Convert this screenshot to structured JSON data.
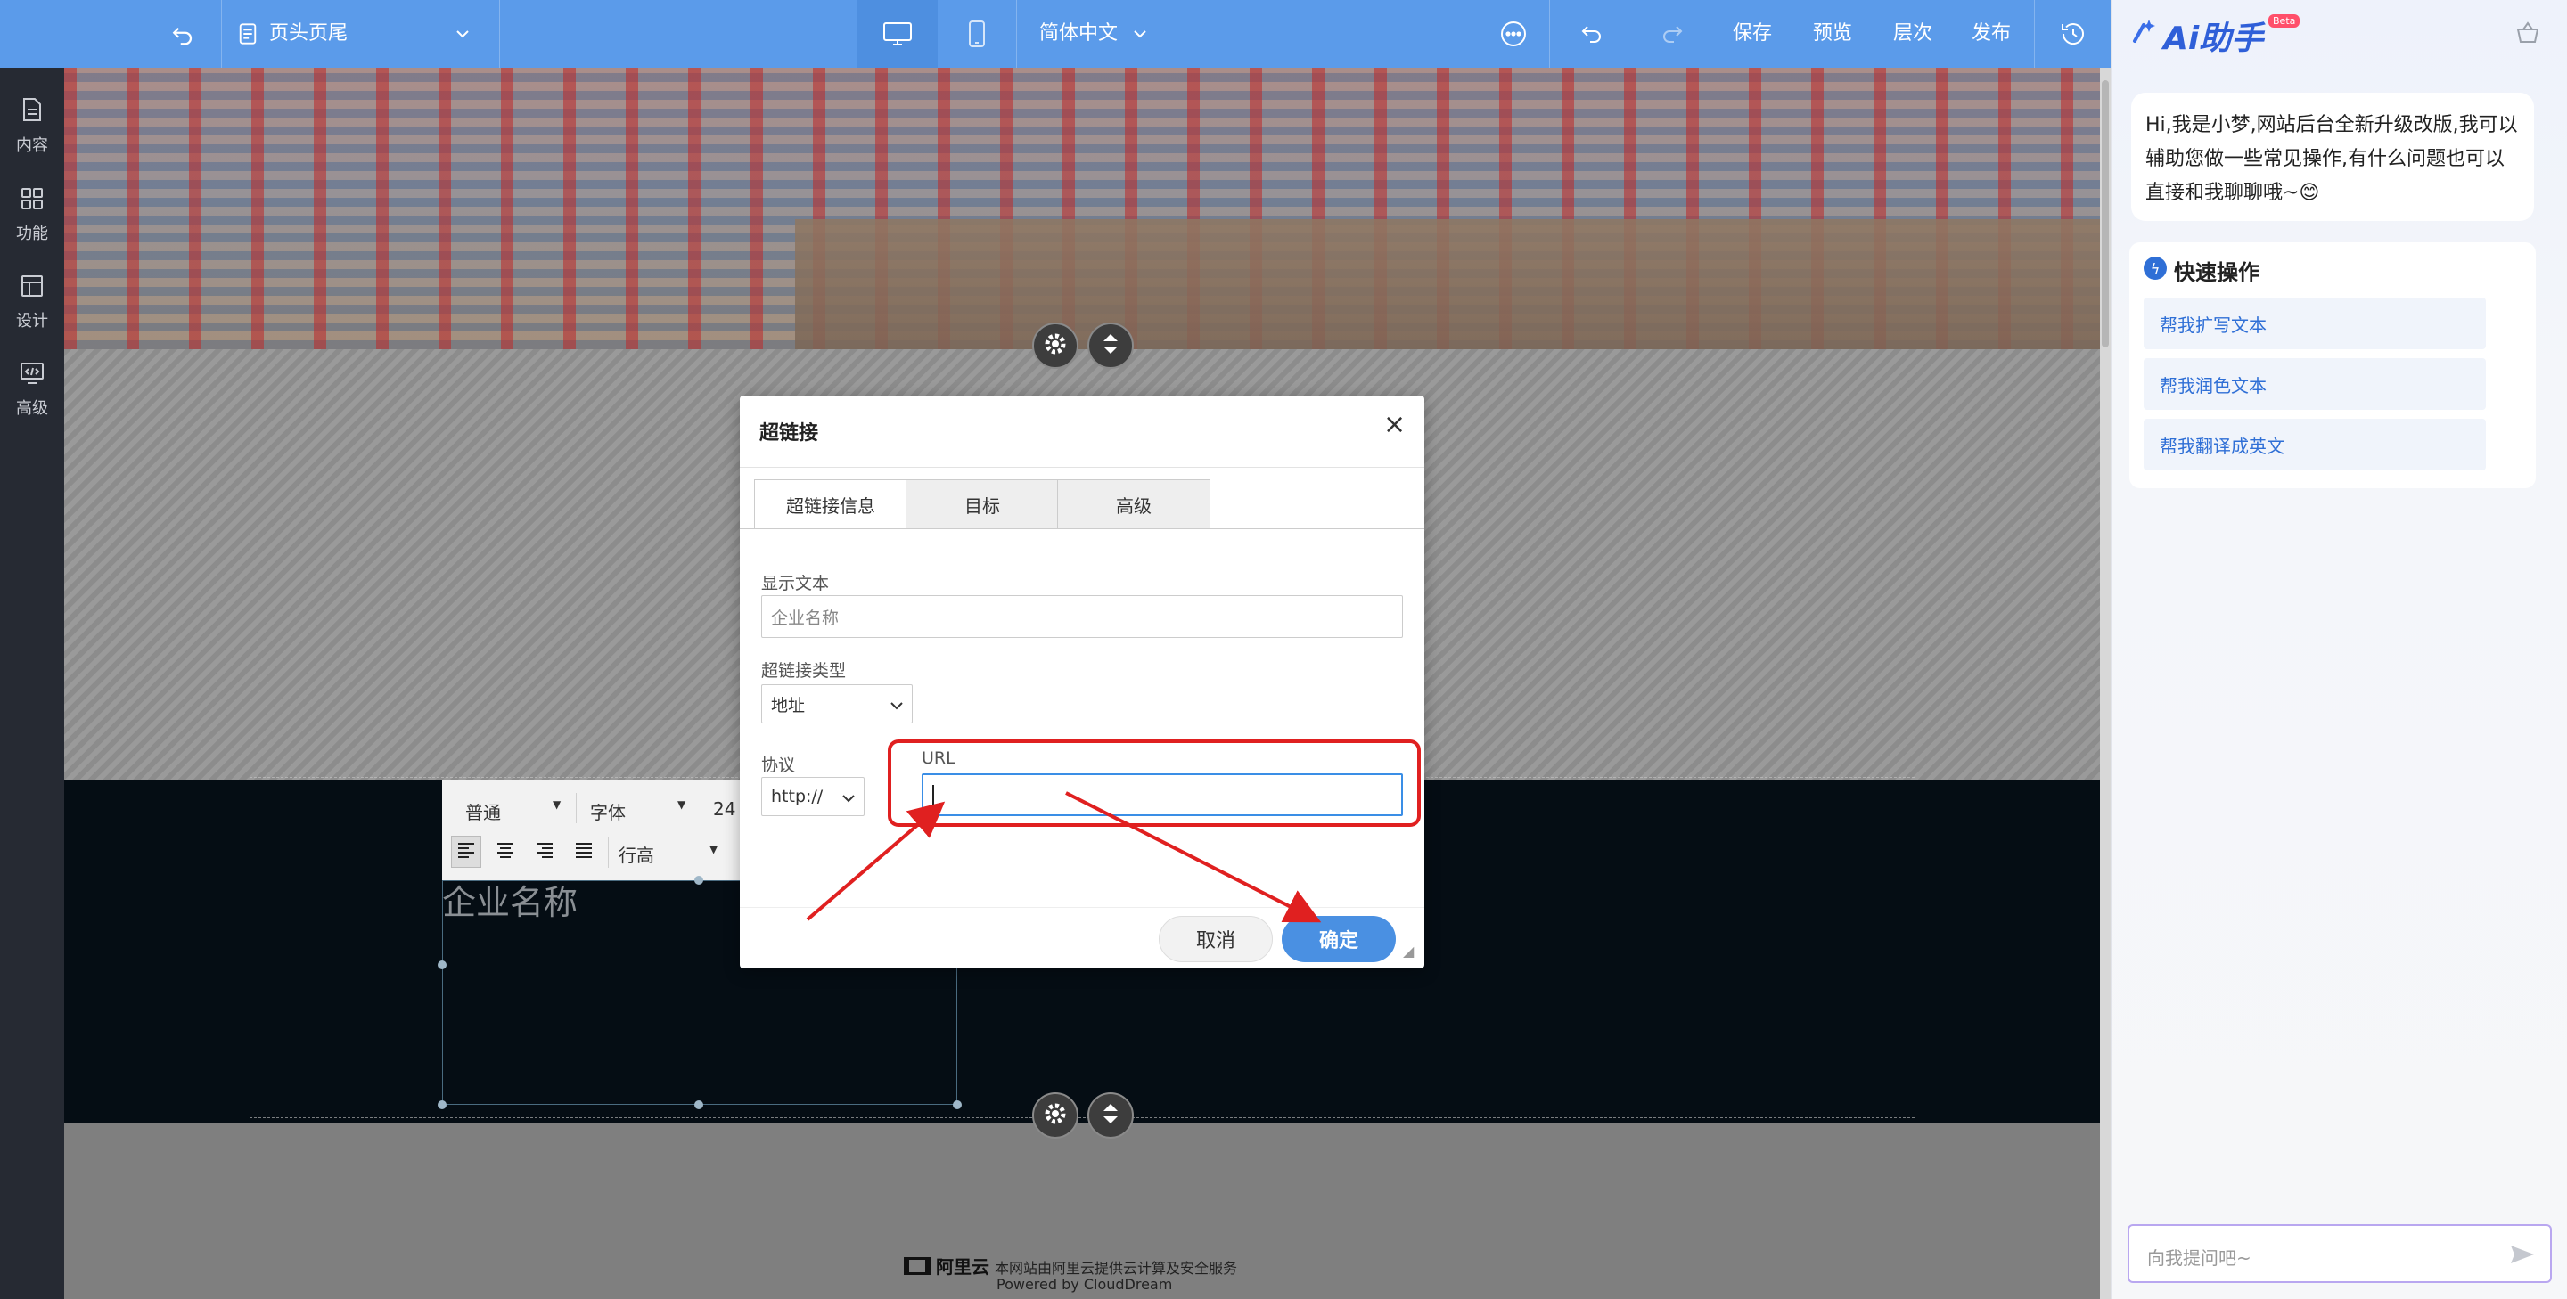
{
  "topbar": {
    "page_selector": "页头页尾",
    "language": "简体中文",
    "save": "保存",
    "preview": "预览",
    "layers": "层次",
    "publish": "发布"
  },
  "leftrail": {
    "items": [
      {
        "label": "内容",
        "icon": "document-icon"
      },
      {
        "label": "功能",
        "icon": "grid-icon"
      },
      {
        "label": "设计",
        "icon": "layout-icon"
      },
      {
        "label": "高级",
        "icon": "code-icon"
      }
    ]
  },
  "editor": {
    "toolbar": {
      "paragraph": "普通",
      "font": "字体",
      "size": "24",
      "line_height": "行高"
    },
    "company_text": "企业名称"
  },
  "footer": {
    "brand": "阿里云",
    "line1": "本网站由阿里云提供云计算及安全服务",
    "line2": "Powered by CloudDream"
  },
  "dialog": {
    "title": "超链接",
    "tabs": [
      "超链接信息",
      "目标",
      "高级"
    ],
    "display_text_label": "显示文本",
    "display_text_placeholder": "企业名称",
    "link_type_label": "超链接类型",
    "link_type_value": "地址",
    "protocol_label": "协议",
    "protocol_value": "http://",
    "url_label": "URL",
    "url_value": "",
    "cancel": "取消",
    "confirm": "确定"
  },
  "assistant": {
    "title": "Ai助手",
    "badge": "Beta",
    "greeting": "Hi,我是小梦,网站后台全新升级改版,我可以辅助您做一些常见操作,有什么问题也可以直接和我聊聊哦~😊",
    "quick_title": "快速操作",
    "quick_actions": [
      "帮我扩写文本",
      "帮我润色文本",
      "帮我翻译成英文"
    ],
    "input_placeholder": "向我提问吧~"
  },
  "colors": {
    "topbar": "#5b9bea",
    "primary_button": "#4a90e2",
    "highlight": "#e02020",
    "rail": "#262a33"
  }
}
